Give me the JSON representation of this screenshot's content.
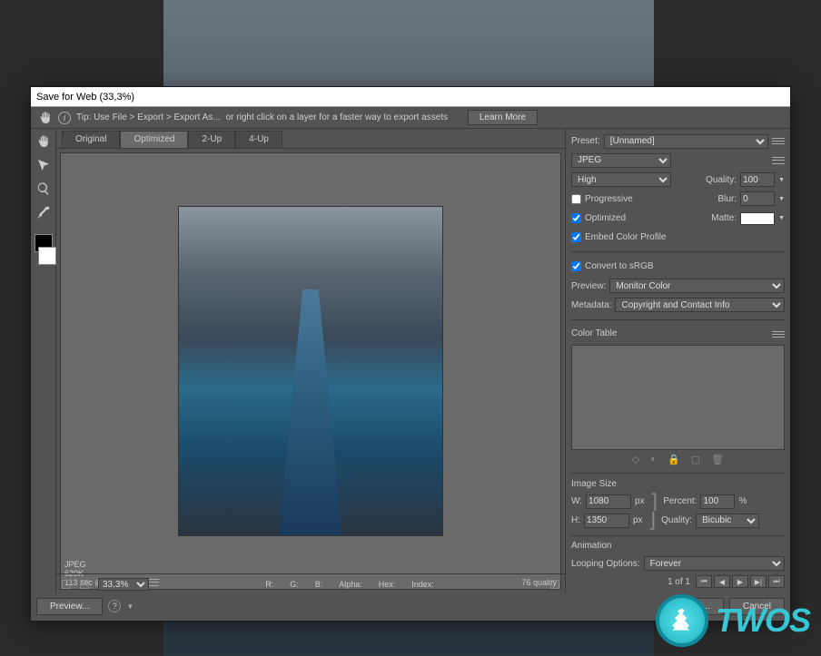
{
  "window": {
    "title": "Save for Web (33,3%)"
  },
  "tip": {
    "prefix": "Tip: Use File > Export > Export As...",
    "suffix": "or right click on a layer for a faster way to export assets",
    "learn_more": "Learn More"
  },
  "tabs": {
    "original": "Original",
    "optimized": "Optimized",
    "two_up": "2-Up",
    "four_up": "4-Up"
  },
  "preview_info": {
    "format": "JPEG",
    "size": "620K",
    "time": "113 sec @ 56.6 Kbps",
    "quality_badge": "76 quality"
  },
  "preset": {
    "label": "Preset:",
    "value": "[Unnamed]"
  },
  "format": {
    "value": "JPEG"
  },
  "quality_level": {
    "value": "High"
  },
  "quality": {
    "label": "Quality:",
    "value": "100"
  },
  "progressive": {
    "label": "Progressive"
  },
  "blur": {
    "label": "Blur:",
    "value": "0"
  },
  "optimized": {
    "label": "Optimized"
  },
  "matte": {
    "label": "Matte:"
  },
  "embed_profile": {
    "label": "Embed Color Profile"
  },
  "convert_srgb": {
    "label": "Convert to sRGB"
  },
  "preview_mode": {
    "label": "Preview:",
    "value": "Monitor Color"
  },
  "metadata": {
    "label": "Metadata:",
    "value": "Copyright and Contact Info"
  },
  "color_table": {
    "label": "Color Table"
  },
  "image_size": {
    "label": "Image Size",
    "w_label": "W:",
    "w_value": "1080",
    "w_unit": "px",
    "h_label": "H:",
    "h_value": "1350",
    "h_unit": "px",
    "percent_label": "Percent:",
    "percent_value": "100",
    "percent_unit": "%",
    "quality_label": "Quality:",
    "quality_value": "Bicubic"
  },
  "animation": {
    "label": "Animation",
    "looping_label": "Looping Options:",
    "looping_value": "Forever",
    "frame_info": "1 of 1"
  },
  "bottombar": {
    "zoom": "33,3%",
    "r": "R:",
    "g": "G:",
    "b": "B:",
    "alpha": "Alpha:",
    "hex": "Hex:",
    "index": "Index:"
  },
  "buttons": {
    "preview": "Preview...",
    "save": "Save...",
    "cancel": "Cancel"
  },
  "brand": {
    "text": "TWOS"
  }
}
